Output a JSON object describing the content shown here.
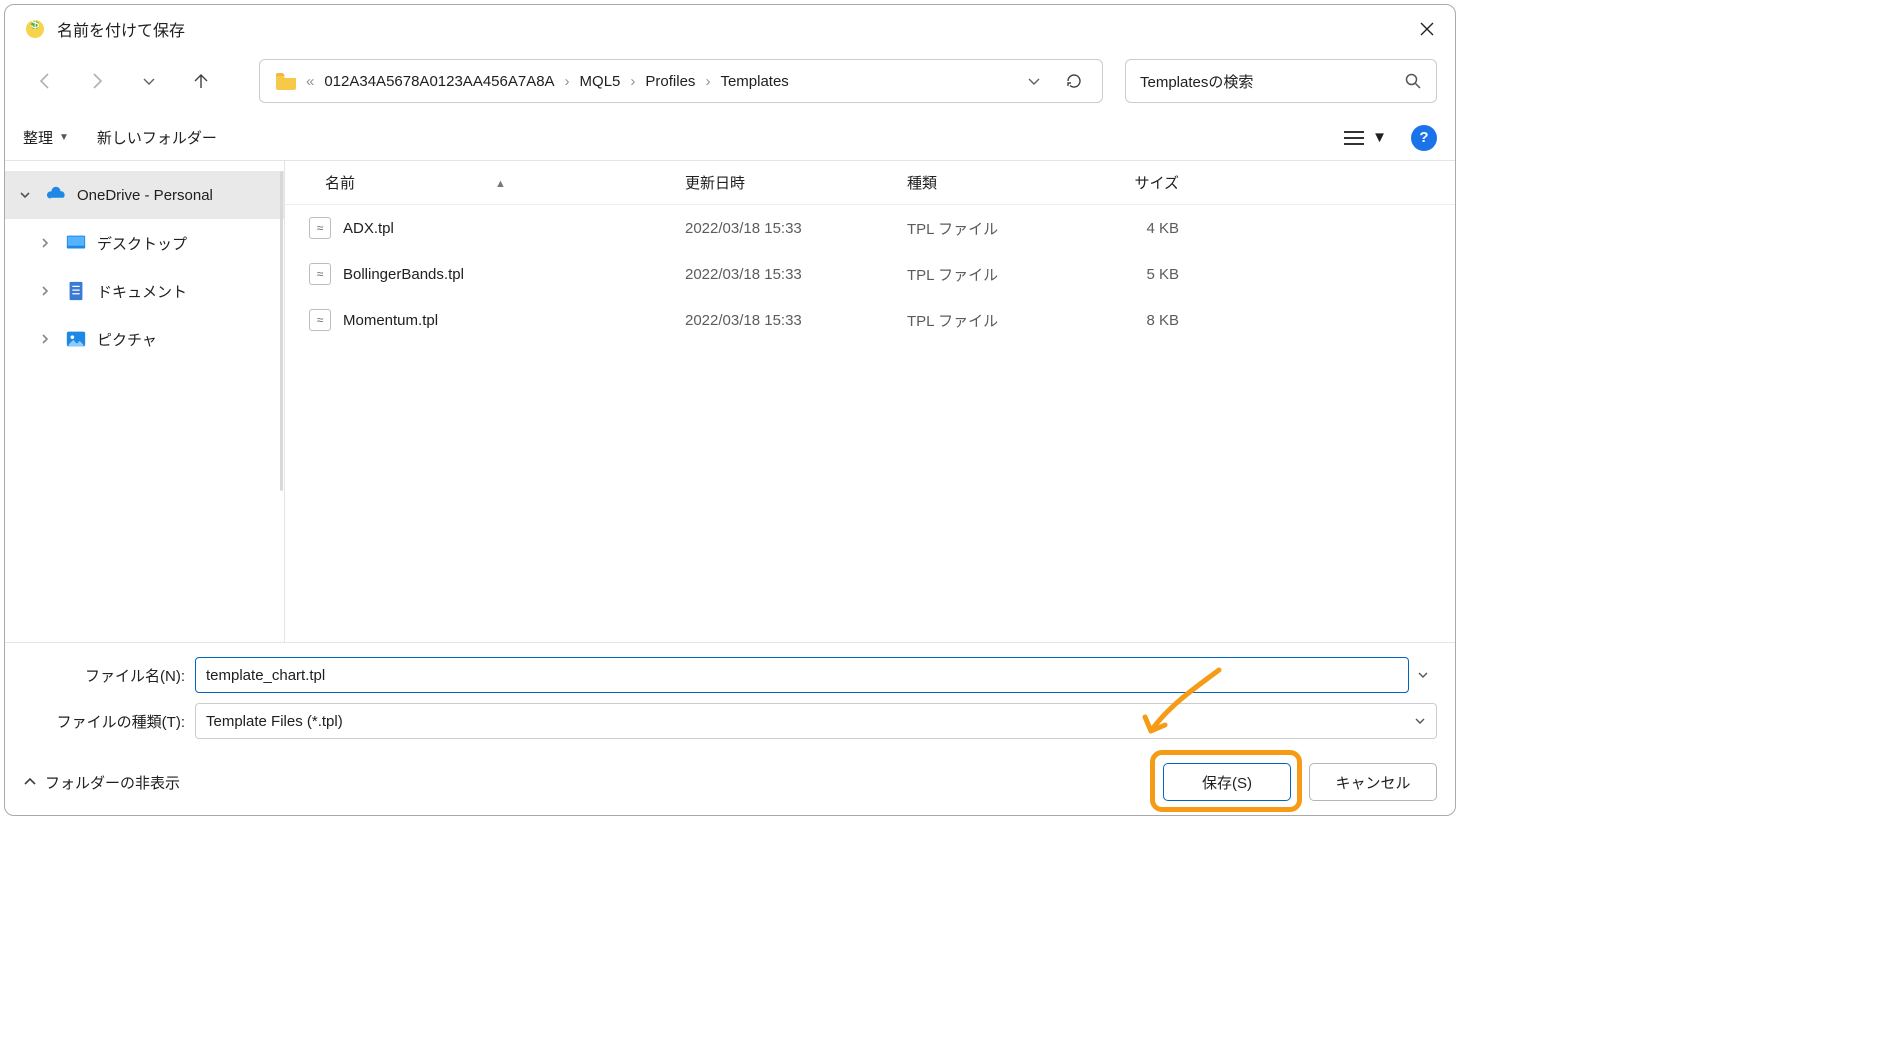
{
  "window": {
    "title": "名前を付けて保存"
  },
  "nav": {
    "path_prefix": "«",
    "path_root": "012A34A5678A0123AA456A7A8A",
    "crumbs": [
      "MQL5",
      "Profiles",
      "Templates"
    ],
    "search_placeholder": "Templatesの検索"
  },
  "toolbar": {
    "organize": "整理",
    "new_folder": "新しいフォルダー"
  },
  "sidebar": {
    "items": [
      {
        "label": "OneDrive - Personal",
        "icon": "onedrive",
        "expanded": true,
        "active": true,
        "indent": false
      },
      {
        "label": "デスクトップ",
        "icon": "desktop",
        "expanded": false,
        "active": false,
        "indent": true
      },
      {
        "label": "ドキュメント",
        "icon": "document",
        "expanded": false,
        "active": false,
        "indent": true
      },
      {
        "label": "ピクチャ",
        "icon": "pictures",
        "expanded": false,
        "active": false,
        "indent": true
      }
    ]
  },
  "columns": {
    "name": "名前",
    "date": "更新日時",
    "type": "種類",
    "size": "サイズ"
  },
  "files": [
    {
      "name": "ADX.tpl",
      "date": "2022/03/18 15:33",
      "type": "TPL ファイル",
      "size": "4 KB"
    },
    {
      "name": "BollingerBands.tpl",
      "date": "2022/03/18 15:33",
      "type": "TPL ファイル",
      "size": "5 KB"
    },
    {
      "name": "Momentum.tpl",
      "date": "2022/03/18 15:33",
      "type": "TPL ファイル",
      "size": "8 KB"
    }
  ],
  "fields": {
    "filename_label": "ファイル名(N):",
    "filename_value": "template_chart.tpl",
    "filetype_label": "ファイルの種類(T):",
    "filetype_value": "Template Files (*.tpl)"
  },
  "footer": {
    "hide_folders": "フォルダーの非表示",
    "save": "保存(S)",
    "cancel": "キャンセル"
  }
}
